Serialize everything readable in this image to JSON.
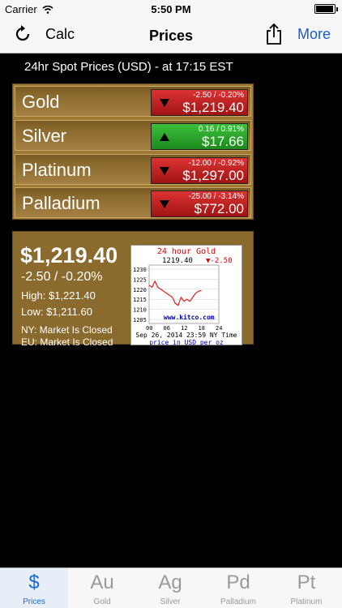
{
  "status_bar": {
    "carrier": "Carrier",
    "time": "5:50 PM"
  },
  "nav": {
    "left_label": "Calc",
    "title": "Prices",
    "right_label": "More"
  },
  "header": {
    "text": "24hr Spot Prices (USD) - at 17:15 EST"
  },
  "prices": [
    {
      "metal": "Gold",
      "change": "-2.50 / -0.20%",
      "price": "$1,219.40",
      "direction": "down"
    },
    {
      "metal": "Silver",
      "change": "0.16 / 0.91%",
      "price": "$17.66",
      "direction": "up"
    },
    {
      "metal": "Platinum",
      "change": "-12.00 / -0.92%",
      "price": "$1,297.00",
      "direction": "down"
    },
    {
      "metal": "Palladium",
      "change": "-25.00 / -3.14%",
      "price": "$772.00",
      "direction": "down"
    }
  ],
  "summary": {
    "price": "$1,219.40",
    "change": "-2.50 / -0.20%",
    "high": "High: $1,221.40",
    "low": "Low: $1,211.60",
    "ny": "NY: Market Is Closed",
    "eu": "EU: Market Is Closed"
  },
  "chart_data": {
    "type": "line",
    "title": "24 hour Gold",
    "current": "1219.40",
    "change": "-2.50",
    "ylabels": [
      "1230",
      "1225",
      "1220",
      "1215",
      "1210",
      "1205"
    ],
    "xlabels": [
      "00",
      "06",
      "12",
      "18",
      "24"
    ],
    "brand": "www.kitco.com",
    "footer": "Sep 26, 2014 23:59 NY Time",
    "note": "price in USD per oz",
    "x": [
      0,
      1,
      2,
      3,
      4,
      5,
      6,
      7,
      8,
      9,
      10,
      11,
      12,
      13,
      14,
      15,
      16,
      17,
      18
    ],
    "values": [
      1222,
      1221,
      1224,
      1221,
      1220,
      1219,
      1218,
      1217,
      1216,
      1213,
      1212,
      1216,
      1214,
      1215,
      1214,
      1216,
      1218,
      1219,
      1219.4
    ],
    "ylim": [
      1203,
      1232
    ]
  },
  "tabs": [
    {
      "sym": "$",
      "label": "Prices",
      "active": true
    },
    {
      "sym": "Au",
      "label": "Gold",
      "active": false
    },
    {
      "sym": "Ag",
      "label": "Silver",
      "active": false
    },
    {
      "sym": "Pd",
      "label": "Palladium",
      "active": false
    },
    {
      "sym": "Pt",
      "label": "Platinum",
      "active": false
    }
  ]
}
